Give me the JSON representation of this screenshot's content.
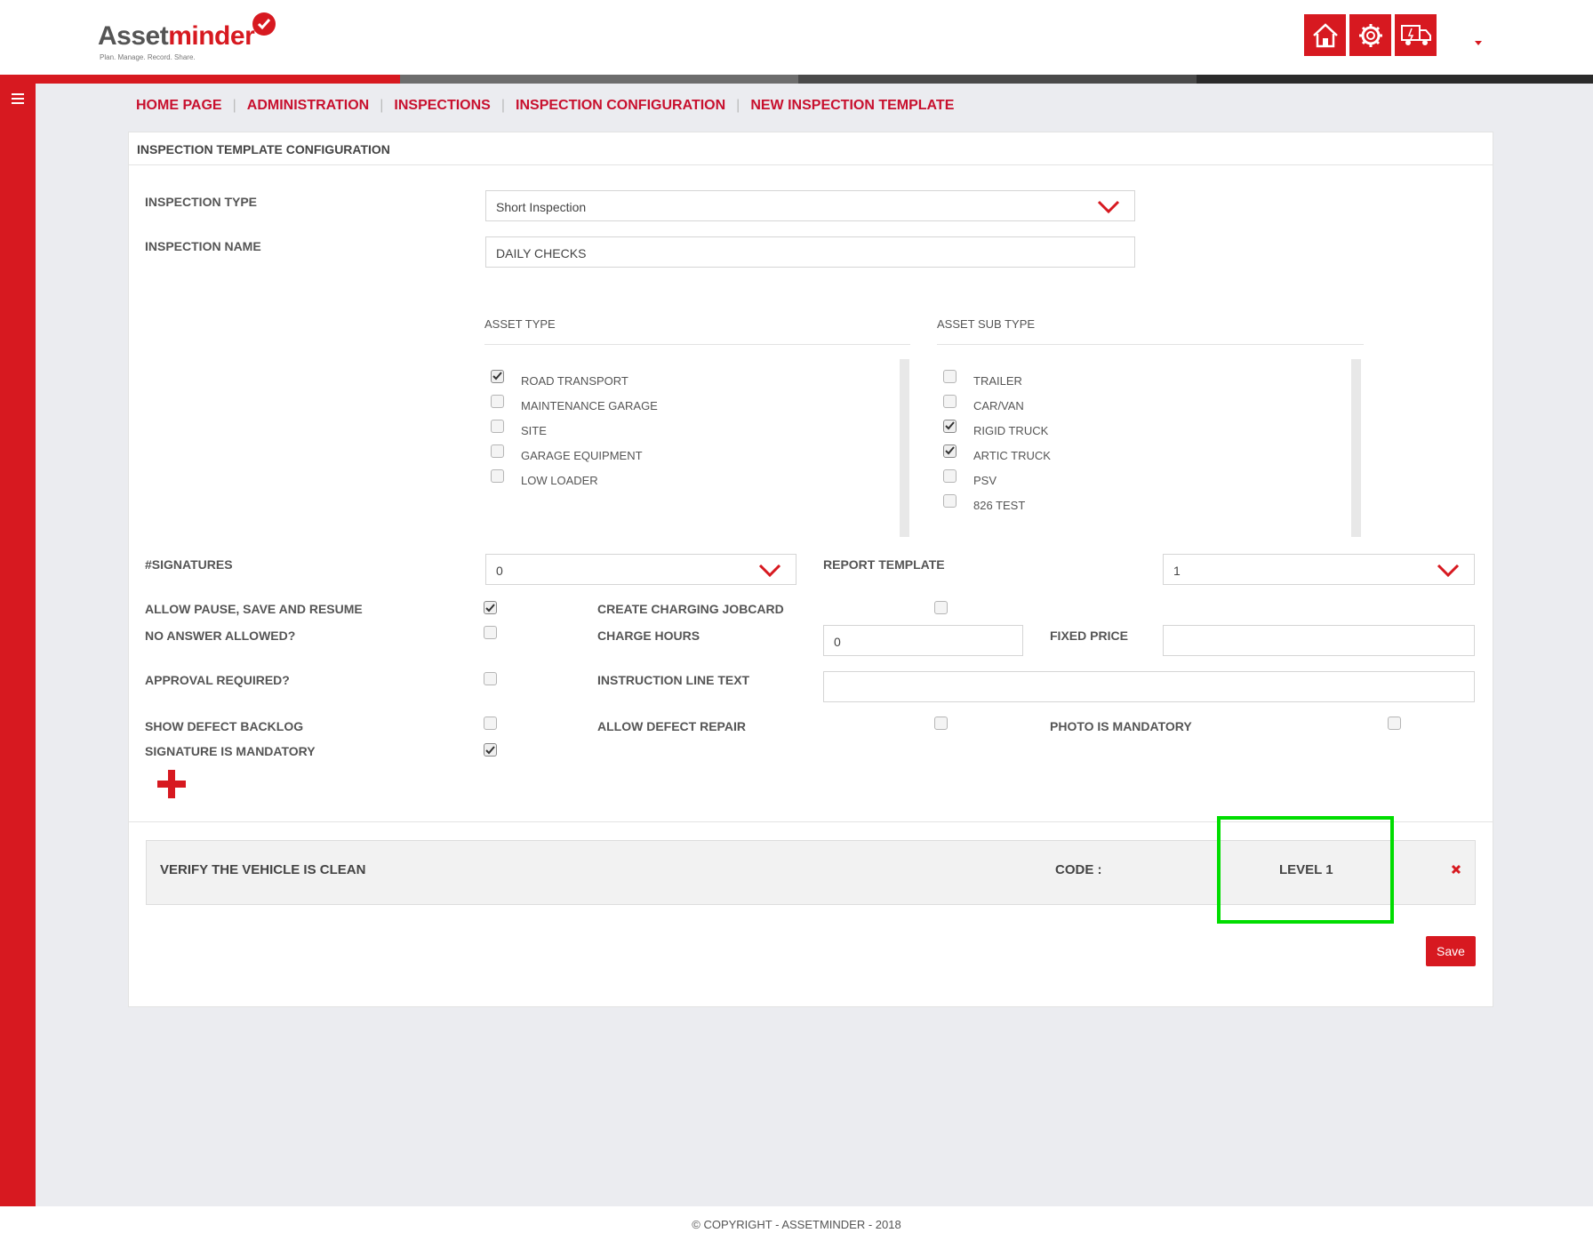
{
  "brand": {
    "name_part1": "Asset",
    "name_part2": "minder",
    "tagline": "Plan. Manage. Record. Share."
  },
  "header": {
    "icons": [
      "home-icon",
      "settings-gear-icon",
      "truck-icon"
    ]
  },
  "breadcrumb": [
    "HOME PAGE",
    "ADMINISTRATION",
    "INSPECTIONS",
    "INSPECTION CONFIGURATION",
    "NEW INSPECTION TEMPLATE"
  ],
  "panel": {
    "title": "INSPECTION TEMPLATE CONFIGURATION"
  },
  "form": {
    "inspection_type": {
      "label": "INSPECTION TYPE",
      "value": "Short Inspection"
    },
    "inspection_name": {
      "label": "INSPECTION NAME",
      "value": "DAILY CHECKS"
    },
    "asset_type": {
      "label": "ASSET TYPE",
      "items": [
        {
          "label": "ROAD TRANSPORT",
          "checked": true
        },
        {
          "label": "MAINTENANCE GARAGE",
          "checked": false
        },
        {
          "label": "SITE",
          "checked": false
        },
        {
          "label": "GARAGE EQUIPMENT",
          "checked": false
        },
        {
          "label": "LOW LOADER",
          "checked": false
        }
      ]
    },
    "asset_sub_type": {
      "label": "ASSET SUB TYPE",
      "items": [
        {
          "label": "TRAILER",
          "checked": false
        },
        {
          "label": "CAR/VAN",
          "checked": false
        },
        {
          "label": "RIGID TRUCK",
          "checked": true
        },
        {
          "label": "ARTIC TRUCK",
          "checked": true
        },
        {
          "label": "PSV",
          "checked": false
        },
        {
          "label": "826 TEST",
          "checked": false
        }
      ]
    },
    "signatures": {
      "label": "#SIGNATURES",
      "value": "0"
    },
    "report_template": {
      "label": "REPORT TEMPLATE",
      "value": "1"
    },
    "allow_pause": {
      "label": "ALLOW PAUSE, SAVE AND RESUME",
      "checked": true
    },
    "create_charging_jobcard": {
      "label": "CREATE CHARGING JOBCARD",
      "checked": false
    },
    "no_answer_allowed": {
      "label": "NO ANSWER ALLOWED?",
      "checked": false
    },
    "charge_hours": {
      "label": "CHARGE HOURS",
      "value": "0"
    },
    "fixed_price": {
      "label": "FIXED PRICE",
      "value": ""
    },
    "approval_required": {
      "label": "APPROVAL REQUIRED?",
      "checked": false
    },
    "instruction_line_text": {
      "label": "INSTRUCTION LINE TEXT",
      "value": ""
    },
    "show_defect_backlog": {
      "label": "SHOW DEFECT BACKLOG",
      "checked": false
    },
    "allow_defect_repair": {
      "label": "ALLOW DEFECT REPAIR",
      "checked": false
    },
    "photo_is_mandatory": {
      "label": "PHOTO IS MANDATORY",
      "checked": false
    },
    "signature_is_mandatory": {
      "label": "SIGNATURE IS MANDATORY",
      "checked": true
    }
  },
  "inspection_item": {
    "title": "VERIFY THE VEHICLE IS CLEAN",
    "code_label": "CODE :",
    "level": "LEVEL 1"
  },
  "actions": {
    "save_label": "Save"
  },
  "footer": {
    "text": "© COPYRIGHT - ASSETMINDER - 2018"
  },
  "colors": {
    "brand_red": "#d71920",
    "highlight_green": "#00dd00",
    "background": "#ebecf0"
  }
}
